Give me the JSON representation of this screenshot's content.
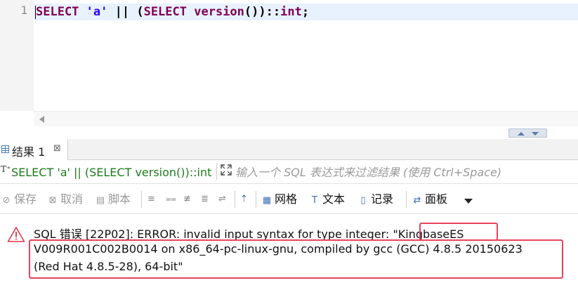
{
  "editor": {
    "line_number": "1",
    "code_tokens": [
      {
        "t": "SELECT",
        "c": "kw"
      },
      {
        "t": " ",
        "c": "op"
      },
      {
        "t": "'a'",
        "c": "str"
      },
      {
        "t": " || (",
        "c": "op"
      },
      {
        "t": "SELECT",
        "c": "kw"
      },
      {
        "t": " ",
        "c": "op"
      },
      {
        "t": "version",
        "c": "kw"
      },
      {
        "t": "())::",
        "c": "op"
      },
      {
        "t": "int",
        "c": "kw"
      },
      {
        "t": ";",
        "c": "op"
      }
    ]
  },
  "results": {
    "tab_label": "结果 1",
    "tab_close": "⊠"
  },
  "filter": {
    "icon": "T⁺",
    "query_text": "SELECT 'a' || (SELECT version())::int",
    "placeholder": "输入一个 SQL 表达式来过滤结果 (使用 Ctrl+Space)"
  },
  "toolbar": {
    "save": "保存",
    "cancel": "取消",
    "script": "脚本",
    "grid": "网格",
    "text": "文本",
    "record": "记录",
    "panel": "面板"
  },
  "error": {
    "line1": "SQL 错误 [22P02]: ERROR: invalid input syntax for type integer: \"KingbaseES",
    "line2": "V009R001C002B0014 on x86_64-pc-linux-gnu, compiled by gcc (GCC) 4.8.5 20150623",
    "line3": "(Red Hat 4.8.5-28), 64-bit\""
  },
  "colors": {
    "keyword": "#7f0055",
    "string": "#2a00ff",
    "query_green": "#1e7b1e",
    "highlight_red": "#e8435a"
  }
}
